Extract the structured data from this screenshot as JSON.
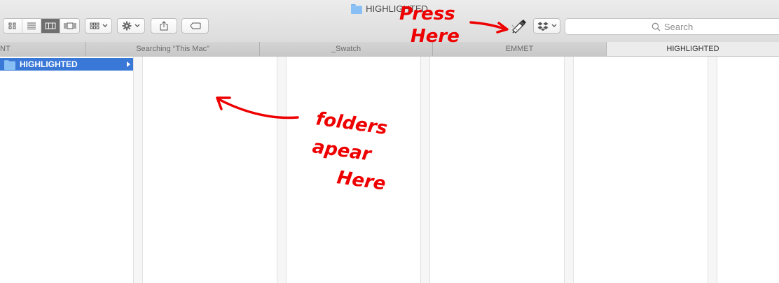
{
  "window": {
    "title": "HIGHLIGHTED"
  },
  "toolbar": {
    "view_modes": [
      "icon-view",
      "list-view",
      "column-view",
      "cover-flow-view"
    ],
    "active_view": "column-view",
    "search_placeholder": "Search"
  },
  "tabs": [
    {
      "label": "NT",
      "active": false
    },
    {
      "label": "Searching “This Mac”",
      "active": false
    },
    {
      "label": "_Swatch",
      "active": false
    },
    {
      "label": "EMMET",
      "active": false
    },
    {
      "label": "HIGHLIGHTED",
      "active": true
    }
  ],
  "columns": {
    "first": {
      "selected_item": "HIGHLIGHTED"
    }
  },
  "annotations": {
    "press": [
      "Press",
      "Here"
    ],
    "folders": [
      "folders",
      "apear",
      "Here"
    ],
    "color": "#ee0000"
  },
  "colors": {
    "selection": "#3a78d8",
    "folder": "#88c0f5"
  }
}
